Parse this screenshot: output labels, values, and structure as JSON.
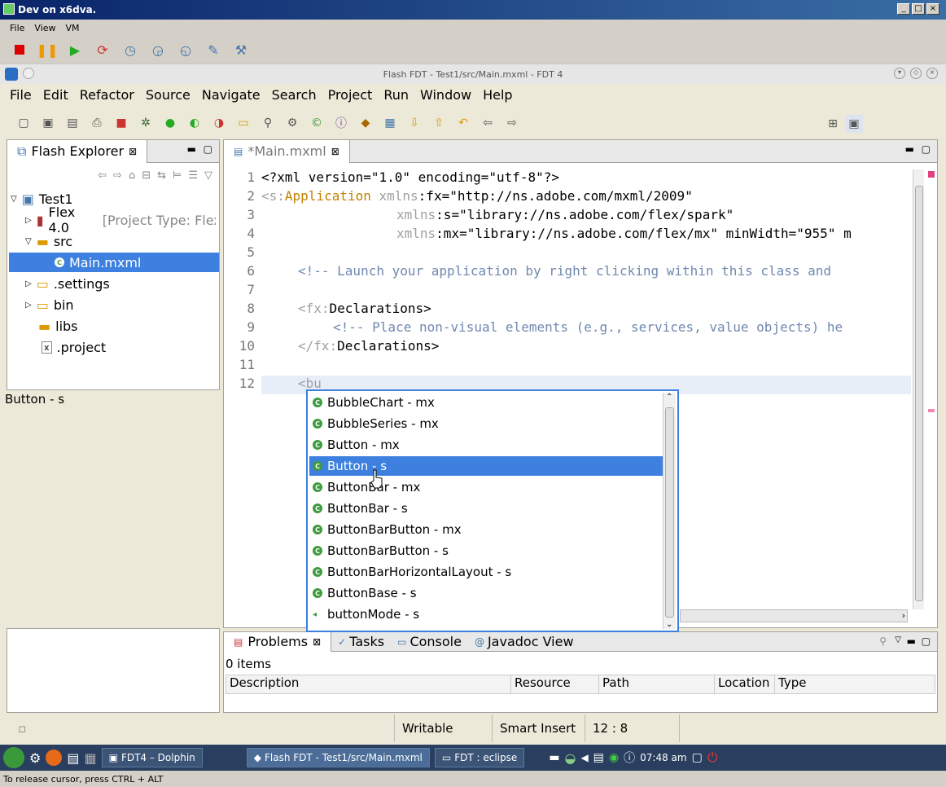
{
  "vbox": {
    "title": "Dev on x6dva.",
    "menu": [
      "File",
      "View",
      "VM"
    ],
    "status": "To release cursor, press CTRL + ALT"
  },
  "eclipse": {
    "title": "Flash FDT - Test1/src/Main.mxml - FDT 4",
    "menu": [
      "File",
      "Edit",
      "Refactor",
      "Source",
      "Navigate",
      "Search",
      "Project",
      "Run",
      "Window",
      "Help"
    ]
  },
  "explorer": {
    "tab": "Flash Explorer",
    "items": [
      {
        "label": "Test1"
      },
      {
        "label": "Flex 4.0",
        "suffix": "[Project Type: Flex"
      },
      {
        "label": "src"
      },
      {
        "label": "Main.mxml"
      },
      {
        "label": ".settings"
      },
      {
        "label": "bin"
      },
      {
        "label": "libs"
      },
      {
        "label": ".project"
      }
    ]
  },
  "editor": {
    "tab": "*Main.mxml",
    "lines": [
      {
        "n": "1",
        "text": "<?xml version=\"1.0\" encoding=\"utf-8\"?>"
      },
      {
        "n": "2",
        "p1": "<s:",
        "p2": "Application",
        "p3": " xmlns",
        "p4": ":fx=\"http://ns.adobe.com/mxml/2009\""
      },
      {
        "n": "3",
        "p3": "xmlns",
        "p4": ":s=\"library://ns.adobe.com/flex/spark\""
      },
      {
        "n": "4",
        "p3": "xmlns",
        "p4": ":mx=\"library://ns.adobe.com/flex/mx\" minWidth=\"955\" m"
      },
      {
        "n": "5",
        "text": ""
      },
      {
        "n": "6",
        "cm": "<!-- Launch your application by right clicking within this class and"
      },
      {
        "n": "7",
        "text": ""
      },
      {
        "n": "8",
        "p1": "<fx:",
        "p2": "Declarations>"
      },
      {
        "n": "9",
        "cm": "<!-- Place non-visual elements (e.g., services, value objects) he"
      },
      {
        "n": "10",
        "p1": "</fx:",
        "p2": "Declarations>"
      },
      {
        "n": "11",
        "text": ""
      },
      {
        "n": "12",
        "p1": "<bu",
        "p2": ""
      }
    ]
  },
  "hover_label": "Button - s",
  "completion": [
    "BubbleChart - mx",
    "BubbleSeries - mx",
    "Button - mx",
    "Button - s",
    "ButtonBar - mx",
    "ButtonBar - s",
    "ButtonBarButton - mx",
    "ButtonBarButton - s",
    "ButtonBarHorizontalLayout - s",
    "ButtonBase - s",
    "buttonMode - s"
  ],
  "bottom": {
    "tabs": [
      "Problems",
      "Tasks",
      "Console",
      "Javadoc View"
    ],
    "count": "0 items",
    "columns": [
      "Description",
      "Resource",
      "Path",
      "Location",
      "Type"
    ]
  },
  "statusbar": {
    "mode": "Writable",
    "insert": "Smart Insert",
    "pos": "12 : 8"
  },
  "taskbar": {
    "tasks": [
      "FDT4 – Dolphin",
      "Flash FDT - Test1/src/Main.mxml",
      "FDT : eclipse"
    ],
    "time": "07:48 am"
  },
  "colors": {
    "selection": "#3d80df",
    "accent": "#0a246a"
  }
}
